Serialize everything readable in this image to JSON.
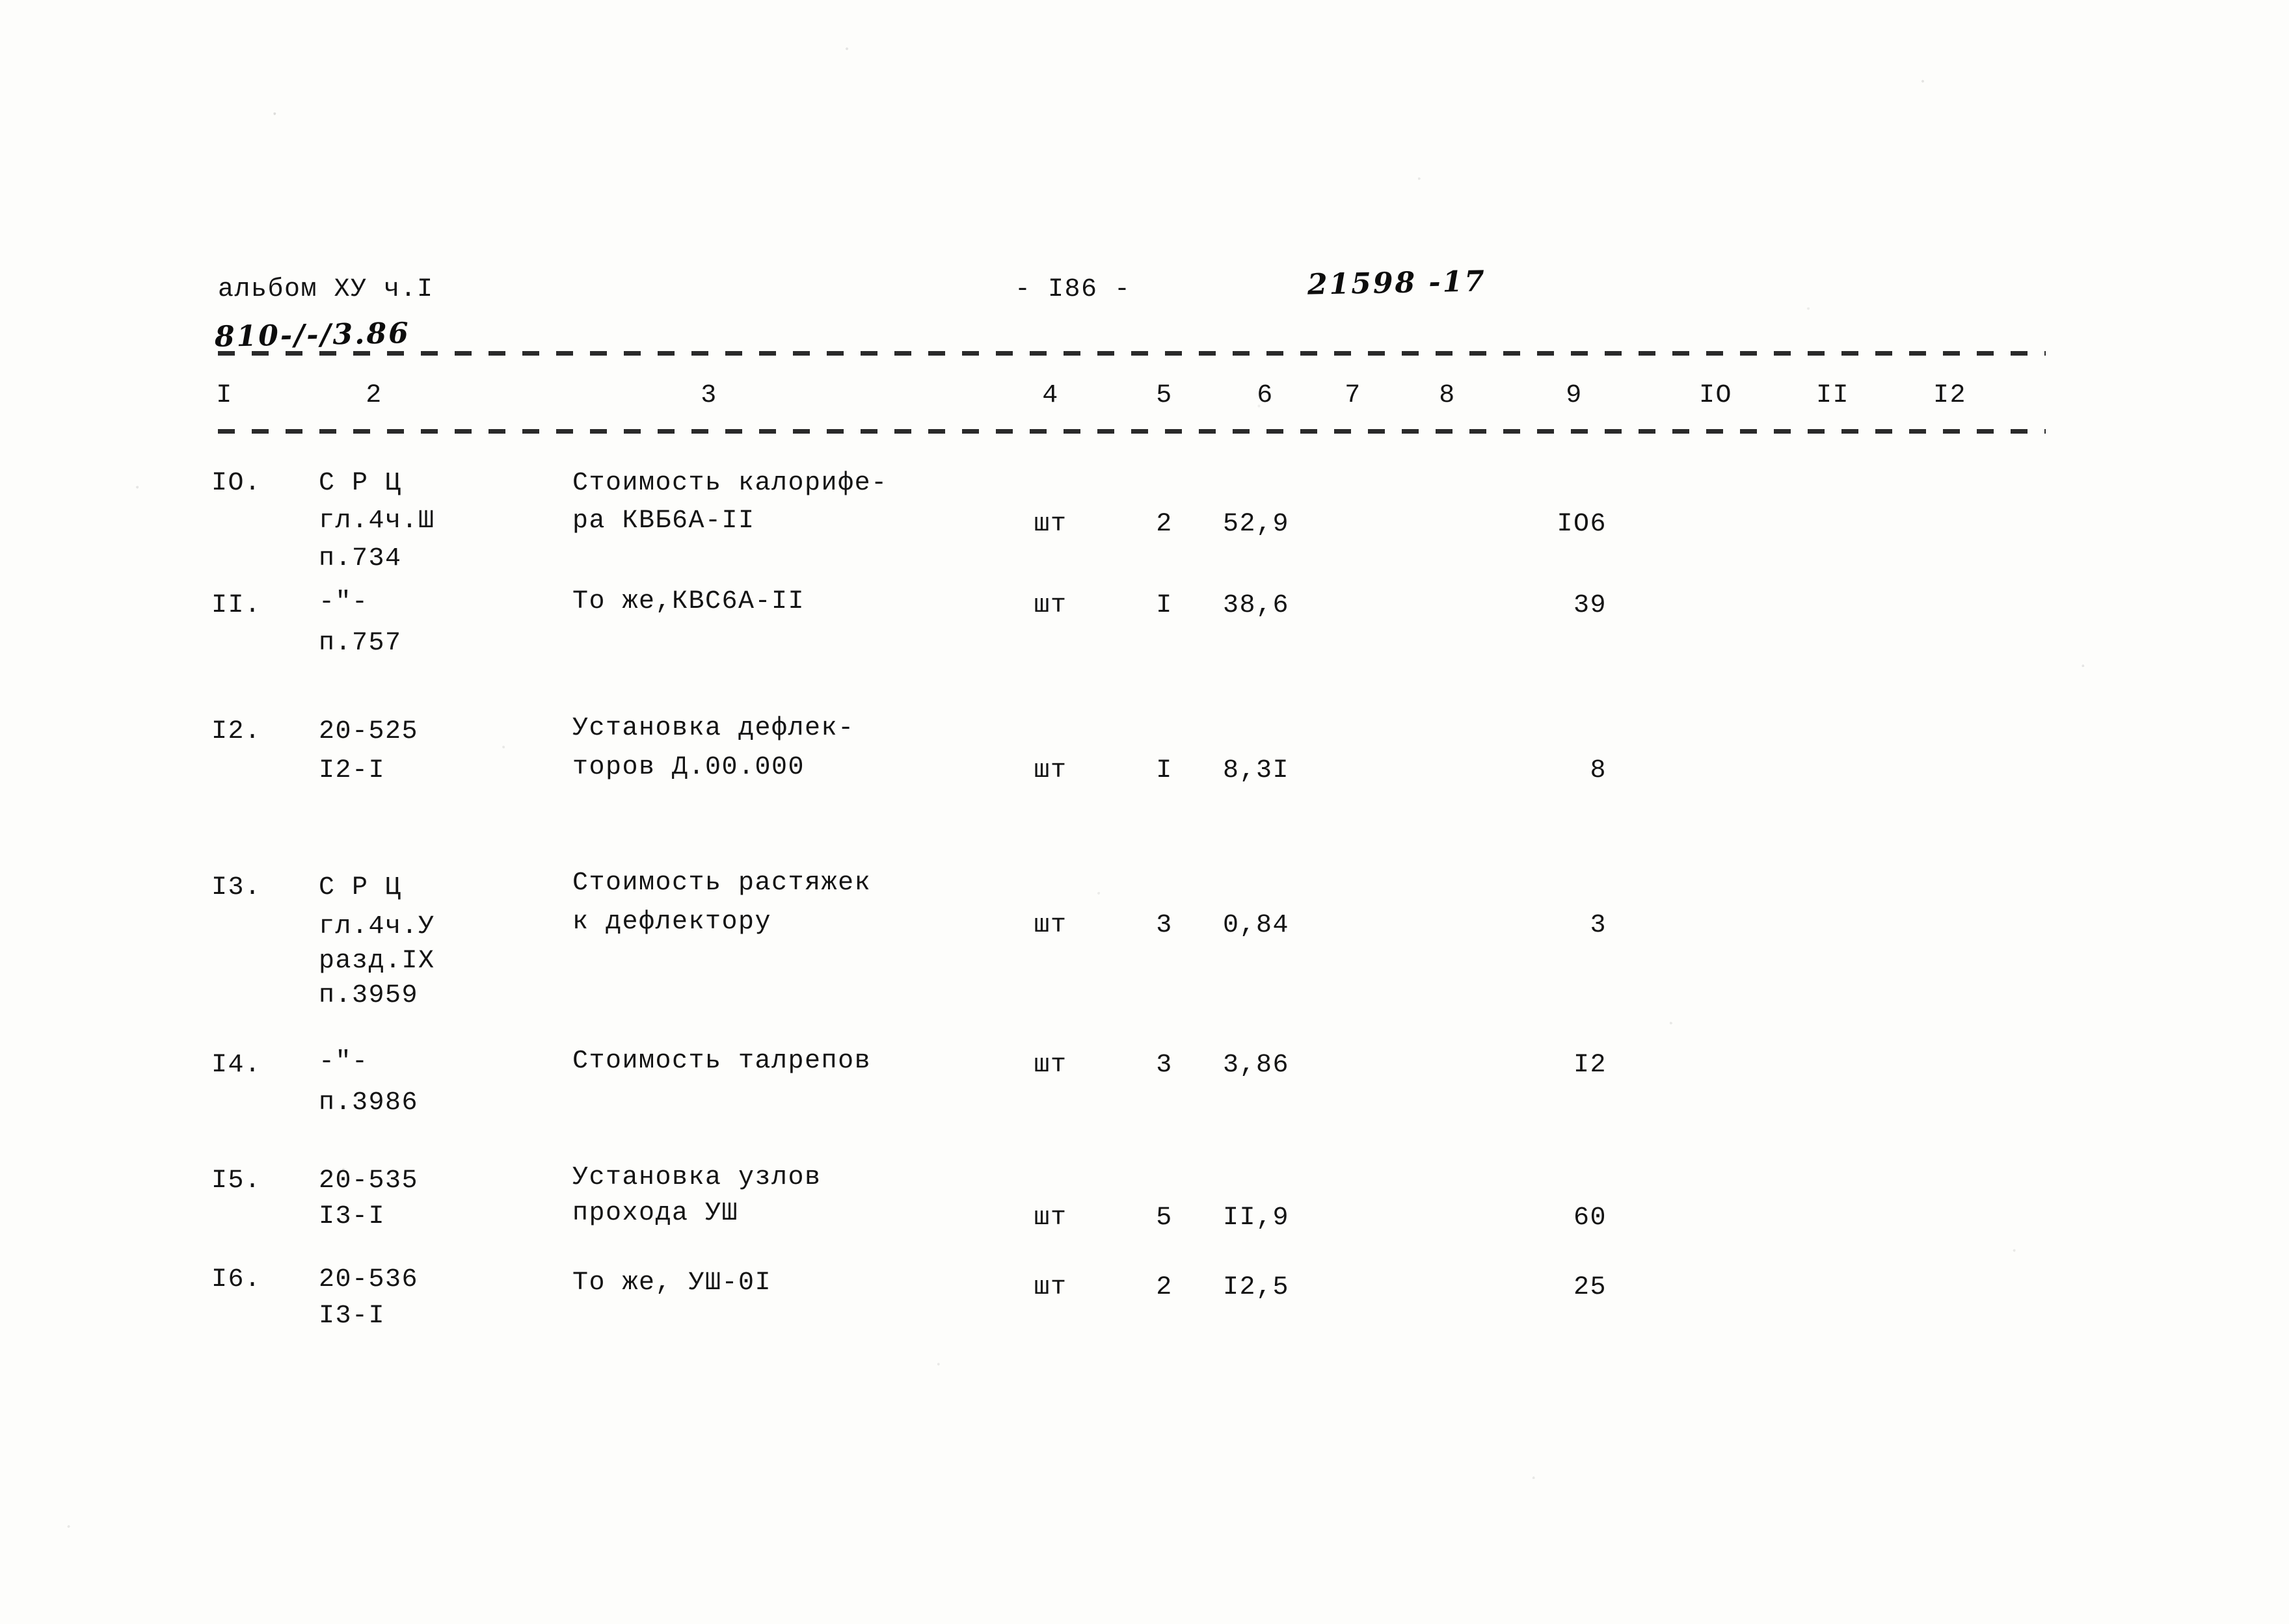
{
  "page": {
    "album_label": "альбом ХУ ч.I",
    "album_code_handwritten": "810-/-/3.86",
    "page_number": "- I86 -",
    "doc_number_handwritten": "21598 -17"
  },
  "table": {
    "column_headers": [
      "I",
      "2",
      "3",
      "4",
      "5",
      "6",
      "7",
      "8",
      "9",
      "IO",
      "II",
      "I2"
    ],
    "rows": [
      {
        "num": "IO.",
        "code_lines": [
          "С Р Ц",
          "гл.4ч.Ш",
          "п.734"
        ],
        "desc_lines": [
          "Стоимость калорифе-",
          "ра КВБ6А-II"
        ],
        "unit": "шт",
        "qty": "2",
        "price": "52,9",
        "c7": "",
        "c8": "",
        "total": "IO6",
        "c10": "",
        "c11": "",
        "c12": ""
      },
      {
        "num": "II.",
        "code_lines": [
          "-\"-",
          "п.757"
        ],
        "desc_lines": [
          "То же,КВС6А-II"
        ],
        "unit": "шт",
        "qty": "I",
        "price": "38,6",
        "c7": "",
        "c8": "",
        "total": "39",
        "c10": "",
        "c11": "",
        "c12": ""
      },
      {
        "num": "I2.",
        "code_lines": [
          "20-525",
          "I2-I"
        ],
        "desc_lines": [
          "Установка дефлек-",
          "торов Д.00.000"
        ],
        "unit": "шт",
        "qty": "I",
        "price": "8,3I",
        "c7": "",
        "c8": "",
        "total": "8",
        "c10": "",
        "c11": "",
        "c12": ""
      },
      {
        "num": "I3.",
        "code_lines": [
          "С Р Ц",
          "гл.4ч.У",
          "разд.IХ",
          "п.3959"
        ],
        "desc_lines": [
          "Стоимость растяжек",
          "к дефлектору"
        ],
        "unit": "шт",
        "qty": "3",
        "price": "0,84",
        "c7": "",
        "c8": "",
        "total": "3",
        "c10": "",
        "c11": "",
        "c12": ""
      },
      {
        "num": "I4.",
        "code_lines": [
          "-\"-",
          "п.3986"
        ],
        "desc_lines": [
          "Стоимость талрепов"
        ],
        "unit": "шт",
        "qty": "3",
        "price": "3,86",
        "c7": "",
        "c8": "",
        "total": "I2",
        "c10": "",
        "c11": "",
        "c12": ""
      },
      {
        "num": "I5.",
        "code_lines": [
          "20-535",
          "I3-I"
        ],
        "desc_lines": [
          "Установка узлов",
          "прохода УШ"
        ],
        "unit": "шт",
        "qty": "5",
        "price": "II,9",
        "c7": "",
        "c8": "",
        "total": "60",
        "c10": "",
        "c11": "",
        "c12": ""
      },
      {
        "num": "I6.",
        "code_lines": [
          "20-536",
          "I3-I"
        ],
        "desc_lines": [
          "То же, УШ-0I"
        ],
        "unit": "шт",
        "qty": "2",
        "price": "I2,5",
        "c7": "",
        "c8": "",
        "total": "25",
        "c10": "",
        "c11": "",
        "c12": ""
      }
    ]
  }
}
